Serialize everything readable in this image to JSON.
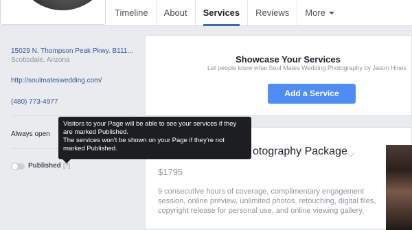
{
  "nav": {
    "tabs": [
      {
        "label": "Timeline"
      },
      {
        "label": "About"
      },
      {
        "label": "Services"
      },
      {
        "label": "Reviews"
      },
      {
        "label": "More"
      }
    ],
    "active_tab": "Services"
  },
  "sidebar": {
    "address_line": "15029 N. Thompson Peak Pkwy. B111...",
    "city": "Scottsdale, Arizona",
    "website": "http://soulmateswedding.com/",
    "phone": "(480) 773-4977",
    "hours": "Always open",
    "published_label": "Published",
    "help_link": "[?]"
  },
  "showcase": {
    "title": "Showcase Your Services",
    "subtitle": "Let people know what Soul Mates Wedding Photography by Jason Hines",
    "add_button": "Add a Service"
  },
  "service": {
    "title_visible": "otography Package",
    "price": "$1795",
    "description": "9 consecutive hours of coverage, complimentary engagement session, online preview, unlimited photos, retouching, digital files, copyright release for personal use, and online viewing gallery."
  },
  "tooltip": {
    "line1": "Visitors to your Page will be able to see your services if they are marked Published.",
    "line2": "The services won't be shown on your Page if they're not marked Published."
  },
  "colors": {
    "accent": "#4267b2",
    "button": "#4f8cf5",
    "link": "#365899"
  }
}
